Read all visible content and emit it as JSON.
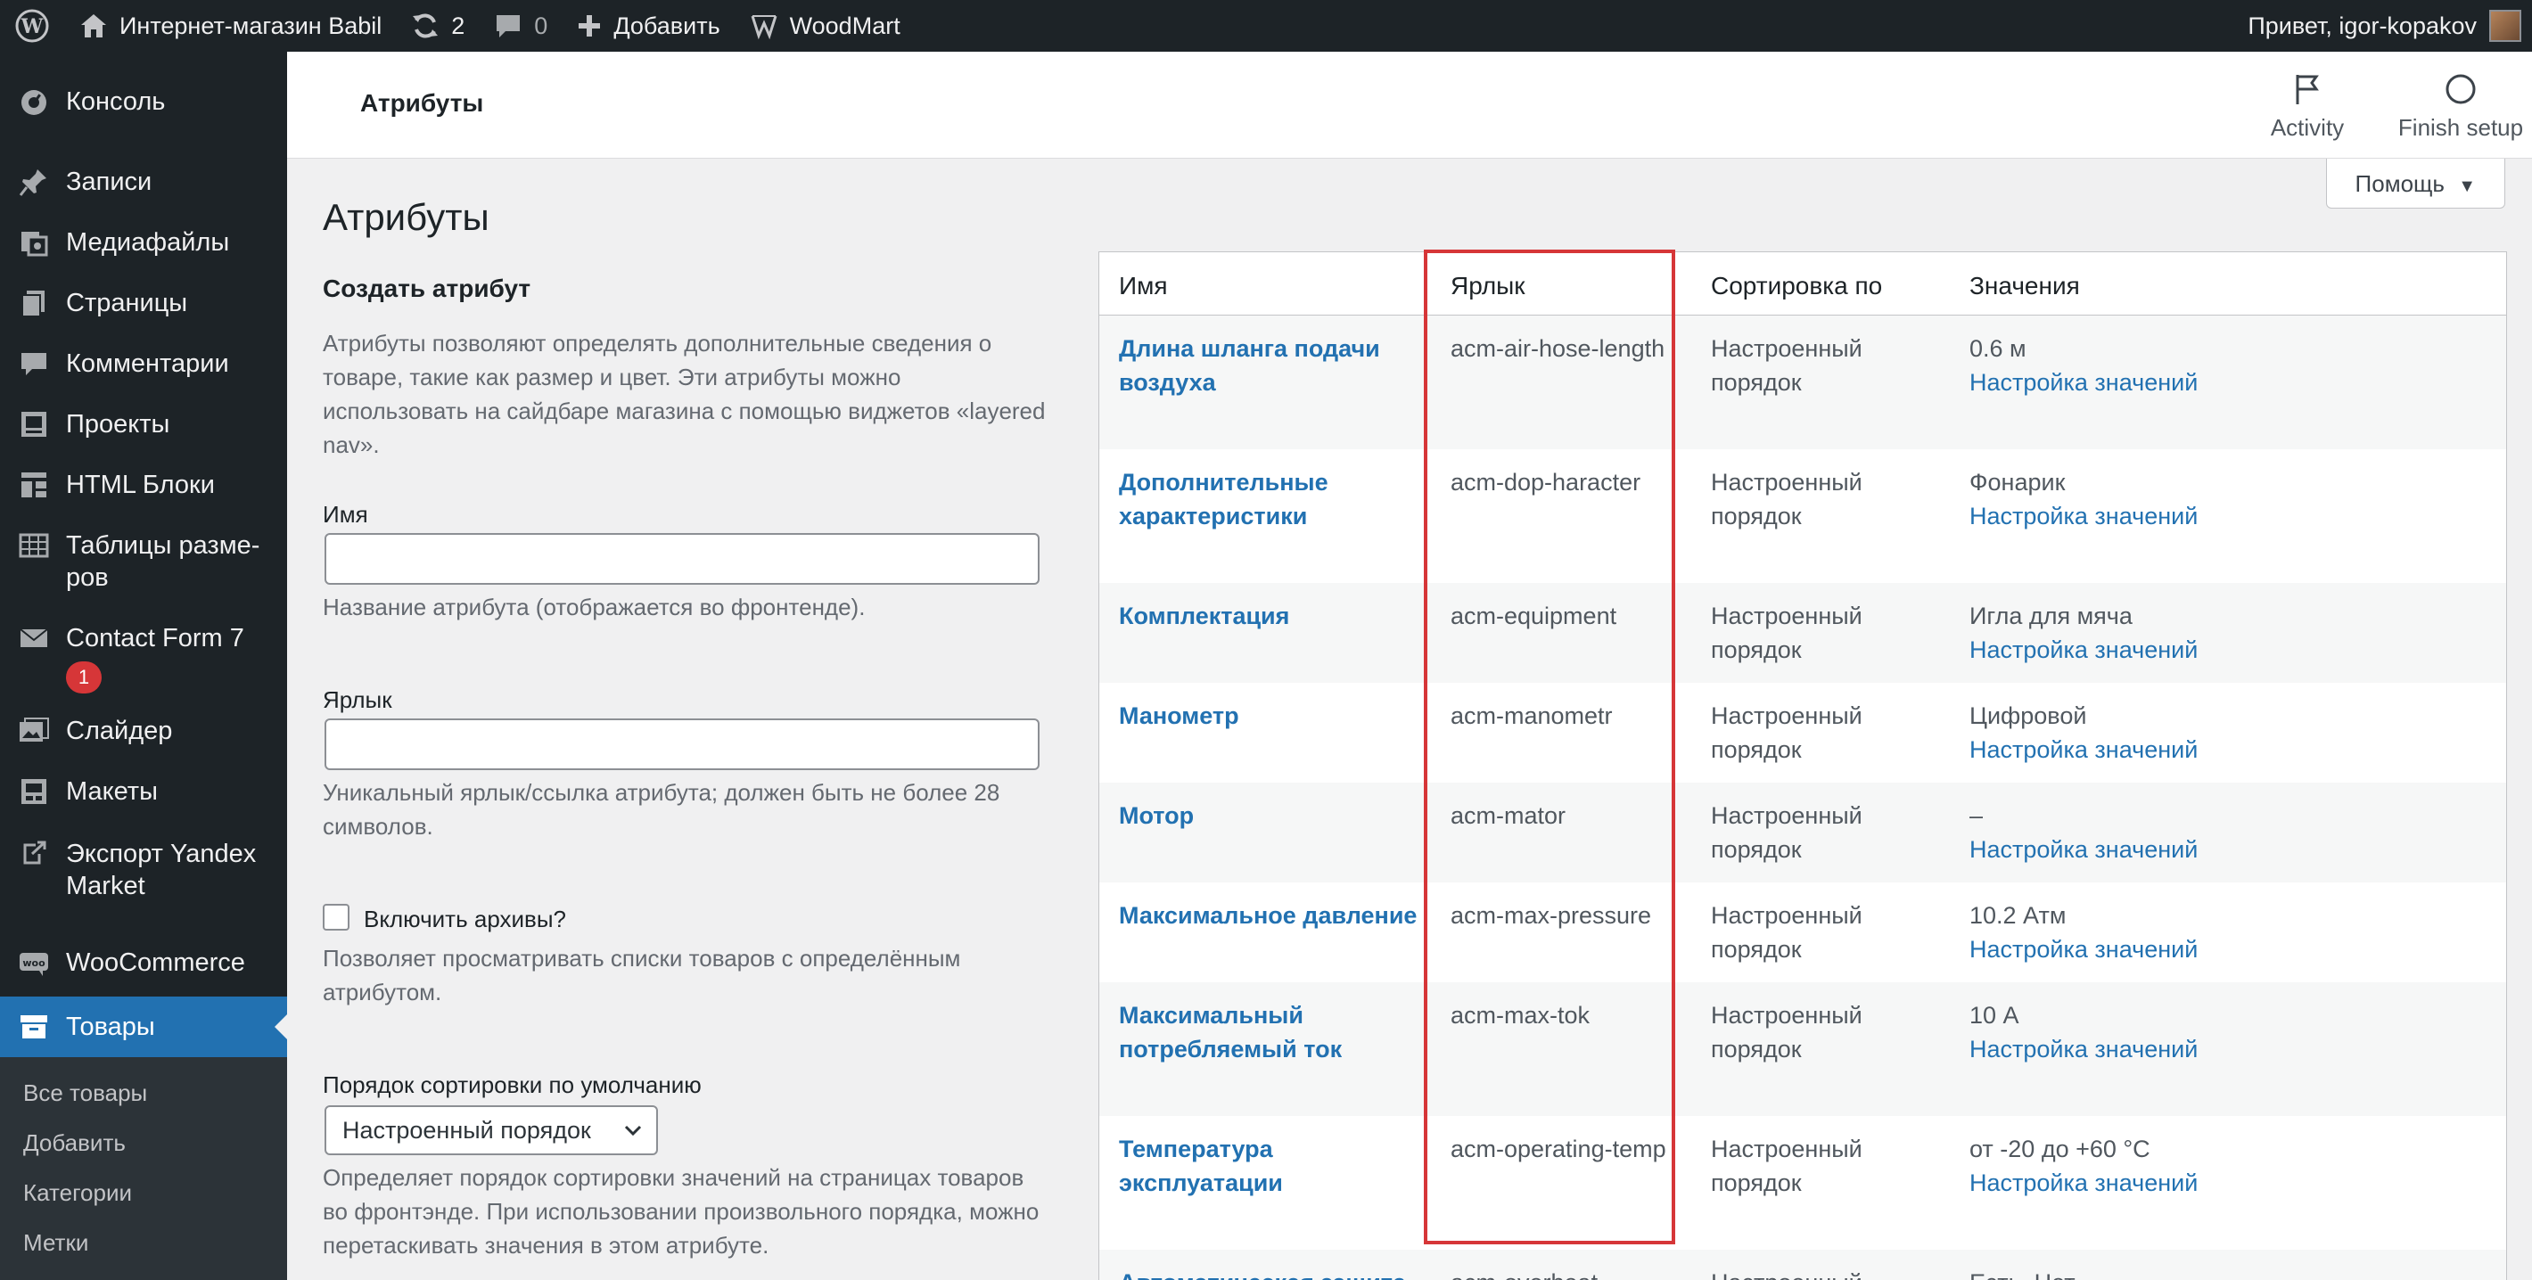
{
  "adminbar": {
    "site_name": "Интернет-магазин Babil",
    "updates": "2",
    "comments": "0",
    "add_new": "Добавить",
    "theme": "WoodMart",
    "greeting": "Привет, igor-kopakov"
  },
  "sidebar": {
    "items": [
      {
        "label": "Консоль",
        "icon": "dashboard-icon"
      },
      {
        "label": "Записи",
        "icon": "pin-icon"
      },
      {
        "label": "Медиафайлы",
        "icon": "media-icon"
      },
      {
        "label": "Страницы",
        "icon": "pages-icon"
      },
      {
        "label": "Комментарии",
        "icon": "comment-icon"
      },
      {
        "label": "Проекты",
        "icon": "portfolio-icon"
      },
      {
        "label": "HTML Блоки",
        "icon": "blocks-icon"
      },
      {
        "label": "Таблицы разме-ров",
        "icon": "table-icon"
      },
      {
        "label": "Contact Form 7",
        "icon": "mail-icon",
        "badge": "1"
      },
      {
        "label": "Слайдер",
        "icon": "slider-icon"
      },
      {
        "label": "Макеты",
        "icon": "layouts-icon"
      },
      {
        "label": "Экспорт Yandex Market",
        "icon": "export-icon"
      },
      {
        "label": "WooCommerce",
        "icon": "woo-icon"
      },
      {
        "label": "Товары",
        "icon": "archive-icon",
        "current": true
      }
    ],
    "submenu": [
      "Все товары",
      "Добавить",
      "Категории",
      "Метки"
    ]
  },
  "header": {
    "title": "Атрибуты",
    "activity": "Activity",
    "finish_setup": "Finish setup",
    "help": "Помощь"
  },
  "form": {
    "page_title": "Атрибуты",
    "heading": "Создать атрибут",
    "intro": "Атрибуты позволяют определять дополнительные сведения о товаре, такие как размер и цвет. Эти атрибуты можно использовать на сайдбаре магазина с помощью виджетов «layered nav».",
    "name_label": "Имя",
    "name_hint": "Название атрибута (отображается во фронтенде).",
    "slug_label": "Ярлык",
    "slug_hint": "Уникальный ярлык/ссылка атрибута; должен быть не более 28 символов.",
    "archives_label": "Включить архивы?",
    "archives_hint": "Позволяет просматривать списки товаров с определённым атрибутом.",
    "sort_label": "Порядок сортировки по умолчанию",
    "sort_value": "Настроенный порядок",
    "sort_hint": "Определяет порядок сортировки значений на страницах товаров во фронтэнде. При использовании произвольного порядка, можно перетаскивать значения в этом атрибуте."
  },
  "table": {
    "headers": [
      "Имя",
      "Ярлык",
      "Сортировка по",
      "Значения"
    ],
    "configure_link": "Настройка значений",
    "rows": [
      {
        "name": "Длина шланга подачи воздуха",
        "slug": "acm-air-hose-length",
        "order": "Настроенный порядок",
        "values": "0.6 м"
      },
      {
        "name": "Дополнительные характеристики",
        "slug": "acm-dop-haracter",
        "order": "Настроенный порядок",
        "values": "Фонарик"
      },
      {
        "name": "Комплектация",
        "slug": "acm-equipment",
        "order": "Настроенный порядок",
        "values": "Игла для мяча"
      },
      {
        "name": "Манометр",
        "slug": "acm-manometr",
        "order": "Настроенный порядок",
        "values": "Цифровой"
      },
      {
        "name": "Мотор",
        "slug": "acm-mator",
        "order": "Настроенный порядок",
        "values": "–"
      },
      {
        "name": "Максимальное давление",
        "slug": "acm-max-pressure",
        "order": "Настроенный порядок",
        "values": "10.2 Атм"
      },
      {
        "name": "Максимальный потребляемый ток",
        "slug": "acm-max-tok",
        "order": "Настроенный порядок",
        "values": "10 А"
      },
      {
        "name": "Температура эксплуатации",
        "slug": "acm-operating-temp",
        "order": "Настроенный порядок",
        "values": "от -20 до +60 °С"
      },
      {
        "name": "Автоматическая защита",
        "slug": "acm-overheat",
        "order": "Настроенный",
        "values": "Есть, Нет"
      }
    ]
  },
  "colors": {
    "admin_bg": "#1d2327",
    "accent": "#2271b1",
    "highlight": "#d63638"
  }
}
